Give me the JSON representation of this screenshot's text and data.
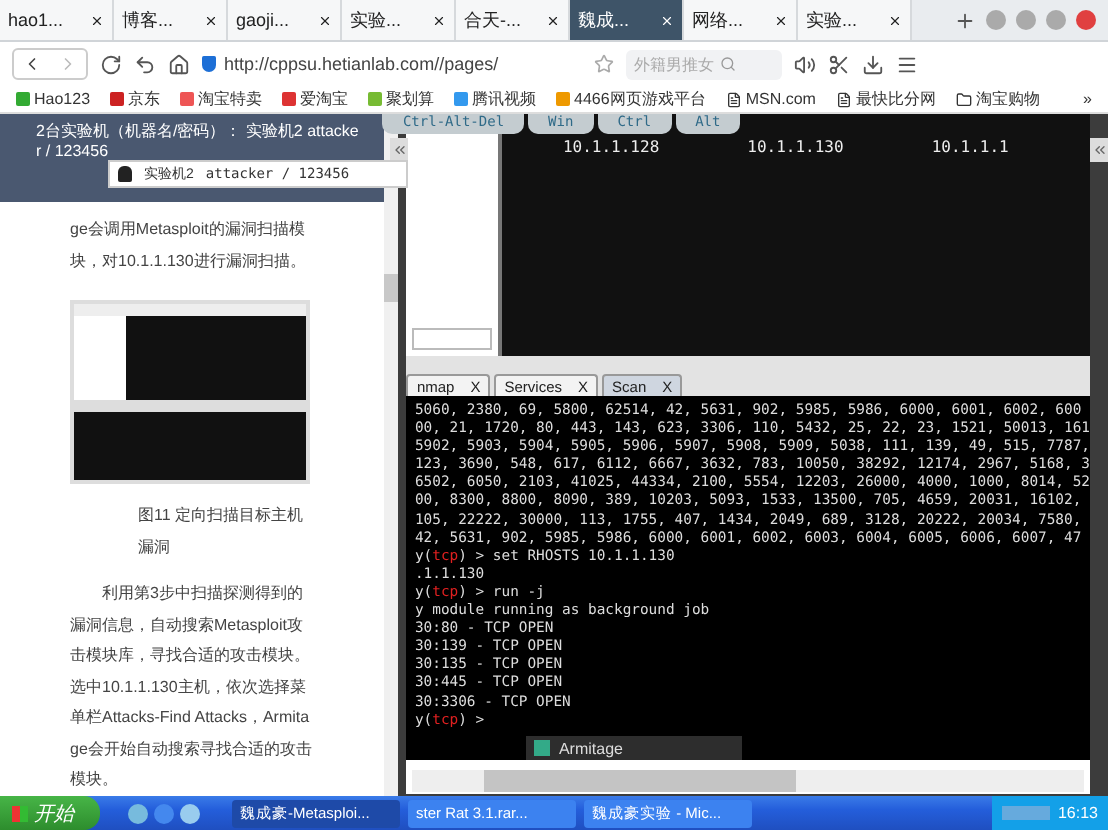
{
  "browser": {
    "tabs": [
      {
        "label": "hao1...",
        "selected": false
      },
      {
        "label": "博客...",
        "selected": false
      },
      {
        "label": "gaoji...",
        "selected": false
      },
      {
        "label": "实验...",
        "selected": false
      },
      {
        "label": "合天-...",
        "selected": false
      },
      {
        "label": "魏成...",
        "selected": true
      },
      {
        "label": "网络...",
        "selected": false
      },
      {
        "label": "实验...",
        "selected": false
      }
    ],
    "address": "http://cppsu.hetianlab.com//pages/",
    "search": {
      "placeholder": "外籍男推女"
    },
    "bookmarks": [
      "Hao123",
      "京东",
      "淘宝特卖",
      "爱淘宝",
      "聚划算",
      "腾讯视频",
      "4466网页游戏平台",
      "MSN.com",
      "最快比分网",
      "淘宝购物"
    ],
    "more": "»"
  },
  "sidebar": {
    "header": "2台实验机（机器名/密码）： 实验机2 attacker / 123456",
    "machine_select": {
      "name": "实验机2",
      "credentials": "attacker / 123456"
    },
    "paragraph_1": "ge会调用Metasploit的漏洞扫描模块，对10.1.1.130进行漏洞扫描。",
    "caption": "图11 定向扫描目标主机漏洞",
    "paragraph_2": "利用第3步中扫描探测得到的漏洞信息，自动搜索Metasploit攻击模块库，寻找合适的攻击模块。选中10.1.1.130主机，依次选择菜单栏Attacks-Find Attacks，Armitage会开始自动搜索寻找合适的攻击模块。"
  },
  "remote": {
    "keys": [
      "Ctrl-Alt-Del",
      "Win",
      "Ctrl",
      "Alt"
    ],
    "hosts": [
      "10.1.1.128",
      "10.1.1.130",
      "10.1.1.1"
    ],
    "tabs": [
      {
        "label": "nmap",
        "close": "X",
        "selected": false
      },
      {
        "label": "Services",
        "close": "X",
        "selected": false
      },
      {
        "label": "Scan",
        "close": "X",
        "selected": true
      }
    ],
    "console": [
      {
        "kind": "text",
        "text": "5060, 2380, 69, 5800, 62514, 42, 5631, 902, 5985, 5986, 6000, 6001, 6002, 600"
      },
      {
        "kind": "text",
        "text": "00, 21, 1720, 80, 443, 143, 623, 3306, 110, 5432, 25, 22, 23, 1521, 50013, 161"
      },
      {
        "kind": "text",
        "text": "5902, 5903, 5904, 5905, 5906, 5907, 5908, 5909, 5038, 111, 139, 49, 515, 7787,"
      },
      {
        "kind": "text",
        "text": "123, 3690, 548, 617, 6112, 6667, 3632, 783, 10050, 38292, 12174, 2967, 5168, 3"
      },
      {
        "kind": "text",
        "text": "6502, 6050, 2103, 41025, 44334, 2100, 5554, 12203, 26000, 4000, 1000, 8014, 52"
      },
      {
        "kind": "text",
        "text": "00, 8300, 8800, 8090, 389, 10203, 5093, 1533, 13500, 705, 4659, 20031, 16102,"
      },
      {
        "kind": "text",
        "text": "105, 22222, 30000, 113, 1755, 407, 1434, 2049, 689, 3128, 20222, 20034, 7580,"
      },
      {
        "kind": "text",
        "text": "42, 5631, 902, 5985, 5986, 6000, 6001, 6002, 6003, 6004, 6005, 6006, 6007, 47"
      },
      {
        "kind": "prompt",
        "prefix": "y(",
        "module": "tcp",
        "command": ") > set RHOSTS 10.1.1.130"
      },
      {
        "kind": "text",
        "text": ".1.1.130"
      },
      {
        "kind": "prompt",
        "prefix": "y(",
        "module": "tcp",
        "command": ") > run -j"
      },
      {
        "kind": "text",
        "text": "y module running as background job"
      },
      {
        "kind": "text",
        "text": "30:80 - TCP OPEN"
      },
      {
        "kind": "text",
        "text": "30:139 - TCP OPEN"
      },
      {
        "kind": "text",
        "text": "30:135 - TCP OPEN"
      },
      {
        "kind": "text",
        "text": "30:445 - TCP OPEN"
      },
      {
        "kind": "text",
        "text": "30:3306 - TCP OPEN"
      },
      {
        "kind": "prompt",
        "prefix": "y(",
        "module": "tcp",
        "command": ") >"
      }
    ],
    "taskbar_item": "Armitage"
  },
  "taskbar": {
    "start": "开始",
    "items": [
      {
        "label": "魏成豪-Metasploi...",
        "selected": true
      },
      {
        "label": "ster Rat 3.1.rar...",
        "selected": false
      },
      {
        "label": "魏成豪实验 - Mic...",
        "selected": false
      }
    ],
    "clock": "16:13"
  }
}
